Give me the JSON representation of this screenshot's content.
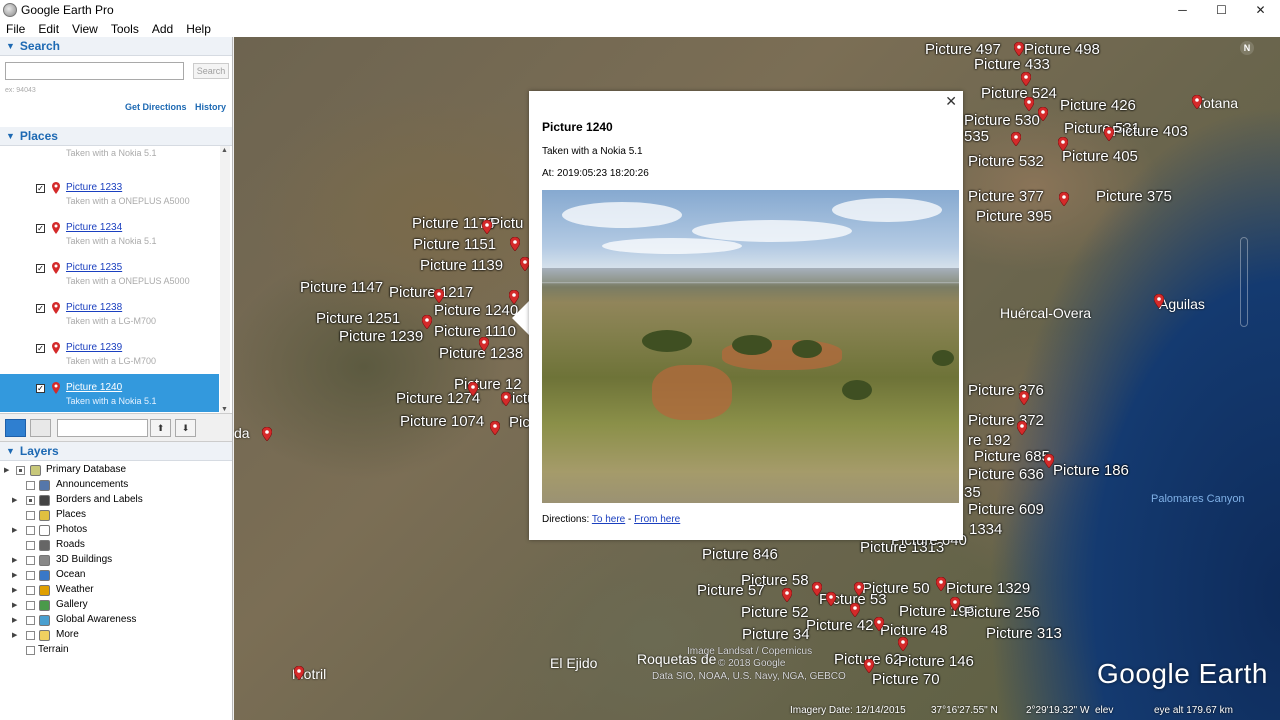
{
  "window": {
    "title": "Google Earth Pro",
    "buttons": {
      "minimize": "─",
      "maximize": "☐",
      "close": "✕"
    }
  },
  "menu": [
    "File",
    "Edit",
    "View",
    "Tools",
    "Add",
    "Help"
  ],
  "search": {
    "header": "Search",
    "placeholder": "",
    "button": "Search",
    "hint": "ex: 94043",
    "get_directions": "Get Directions",
    "history": "History"
  },
  "places": {
    "header": "Places",
    "top_fragment": "Taken with a Nokia 5.1",
    "items": [
      {
        "title": "Picture 1233",
        "subtitle": "Taken with a ONEPLUS A5000",
        "checked": true,
        "selected": false
      },
      {
        "title": "Picture 1234",
        "subtitle": "Taken with a Nokia 5.1",
        "checked": true,
        "selected": false
      },
      {
        "title": "Picture 1235",
        "subtitle": "Taken with a ONEPLUS A5000",
        "checked": true,
        "selected": false
      },
      {
        "title": "Picture 1238",
        "subtitle": "Taken with a LG-M700",
        "checked": true,
        "selected": false
      },
      {
        "title": "Picture 1239",
        "subtitle": "Taken with a LG-M700",
        "checked": true,
        "selected": false
      },
      {
        "title": "Picture 1240",
        "subtitle": "Taken with a Nokia 5.1",
        "checked": true,
        "selected": true
      }
    ]
  },
  "layers": {
    "header": "Layers",
    "items": [
      {
        "label": "Primary Database",
        "icon": "database-icon"
      },
      {
        "label": "Announcements",
        "icon": "mail-icon"
      },
      {
        "label": "Borders and Labels",
        "icon": "flag-icon"
      },
      {
        "label": "Places",
        "icon": "places-icon"
      },
      {
        "label": "Photos",
        "icon": "photo-icon"
      },
      {
        "label": "Roads",
        "icon": "road-icon"
      },
      {
        "label": "3D Buildings",
        "icon": "building-icon"
      },
      {
        "label": "Ocean",
        "icon": "ocean-icon"
      },
      {
        "label": "Weather",
        "icon": "sun-icon"
      },
      {
        "label": "Gallery",
        "icon": "gallery-icon"
      },
      {
        "label": "Global Awareness",
        "icon": "globe-icon"
      },
      {
        "label": "More",
        "icon": "folder-icon"
      },
      {
        "label": "Terrain",
        "icon": ""
      }
    ]
  },
  "balloon": {
    "title": "Picture 1240",
    "camera": "Taken with a Nokia 5.1",
    "timestamp": "At: 2019:05:23 18:20:26",
    "directions_label": "Directions:",
    "to_here": "To here",
    "separator": "-",
    "from_here": "From here",
    "close": "✕"
  },
  "map": {
    "labels": [
      "Picture 497",
      "Picture 498",
      "Picture 433",
      "Picture 524",
      "Picture 426",
      "Picture 530",
      "Picture 531",
      "Picture 403",
      "535",
      "Picture 532",
      "Picture 405",
      "Picture 377",
      "Picture 375",
      "Picture 395",
      "Picture 1170",
      "Pictu",
      "Picture 1151",
      "Picture 1139",
      "Picture 1147",
      "Picture 1217",
      "Picture 1251",
      "Picture 1240",
      "Picture 1239",
      "Picture 1110",
      "Picture 1238",
      "Picture 12",
      "Picture 1274",
      "Pictu",
      "Picture 1074",
      "Pic",
      "Picture 376",
      "Picture 372",
      "re 192",
      "Picture 685",
      "Picture 636",
      "Picture 186",
      "35",
      "Picture 609",
      "1334",
      "Picture 846",
      "Picture 1313",
      "Picture 58",
      "Picture 57",
      "Picture 53",
      "Picture 50",
      "Picture 1329",
      "Picture 52",
      "Picture 196",
      "Picture 256",
      "Picture 42",
      "Picture 48",
      "Picture 34",
      "Picture 313",
      "Picture 62",
      "Picture 146",
      "Picture 70",
      "Picture 640"
    ],
    "cities": [
      "Totana",
      "Huércal-Overa",
      "Aguilas",
      "Motril",
      "El Ejido",
      "Roquetas de",
      "da"
    ],
    "ocean": "Palomares Canyon",
    "copyright": [
      "Image Landsat / Copernicus",
      "© 2018 Google",
      "Data SIO, NOAA, U.S. Navy, NGA, GEBCO"
    ],
    "logo": "Google Earth",
    "north": "N",
    "status": {
      "imagery_date": "Imagery Date: 12/14/2015",
      "lat": "37°16'27.55\" N",
      "lon": "2°29'19.32\" W",
      "elev": "elev",
      "eye_alt": "eye alt 179.67 km"
    }
  },
  "colors": {
    "accent_blue": "#1d69b3",
    "selected_row": "#3399dd",
    "pin_red": "#d42a2a",
    "link": "#1a3fbf"
  }
}
